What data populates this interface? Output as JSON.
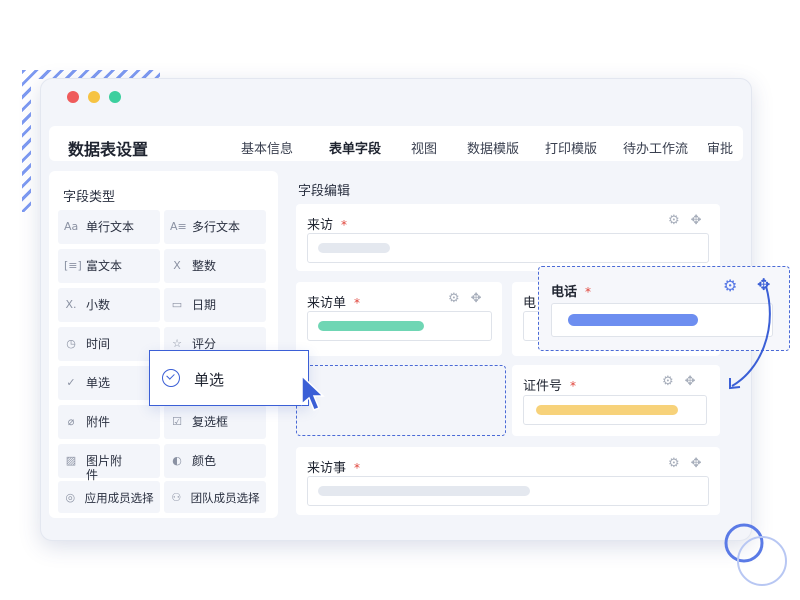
{
  "header": {
    "title": "数据表设置",
    "tabs": [
      {
        "label": "基本信息",
        "active": false
      },
      {
        "label": "表单字段",
        "active": true
      },
      {
        "label": "视图",
        "active": false
      },
      {
        "label": "数据模版",
        "active": false
      },
      {
        "label": "打印模版",
        "active": false
      },
      {
        "label": "待办工作流",
        "active": false
      },
      {
        "label": "审批",
        "active": false
      }
    ]
  },
  "sidebar": {
    "title": "字段类型",
    "items": [
      {
        "icon": "Aa",
        "label": "单行文本"
      },
      {
        "icon": "A≡",
        "label": "多行文本"
      },
      {
        "icon": "[≡]",
        "label": "富文本"
      },
      {
        "icon": "X",
        "label": "整数"
      },
      {
        "icon": "X.",
        "label": "小数"
      },
      {
        "icon": "▭",
        "label": "日期"
      },
      {
        "icon": "◷",
        "label": "时间"
      },
      {
        "icon": "☆",
        "label": "评分"
      },
      {
        "icon": "✓",
        "label": "单选"
      },
      {
        "icon": "",
        "label": ""
      },
      {
        "icon": "⌀",
        "label": "附件"
      },
      {
        "icon": "☑",
        "label": "复选框"
      },
      {
        "icon": "▨",
        "label": "图片附件"
      },
      {
        "icon": "◐",
        "label": "颜色"
      },
      {
        "icon": "◎",
        "label": "应用成员选择"
      },
      {
        "icon": "⚇",
        "label": "团队成员选择"
      }
    ]
  },
  "editor": {
    "title": "字段编辑",
    "fields": {
      "visitor": {
        "label": "来访",
        "required": "*"
      },
      "visit_form": {
        "label": "来访单",
        "required": "*"
      },
      "phone_partial": {
        "label": "电"
      },
      "id_number": {
        "label": "证件号",
        "required": "*"
      },
      "visit_matter": {
        "label": "来访事",
        "required": "*"
      }
    }
  },
  "drag_phone": {
    "label": "电话",
    "required": "*"
  },
  "drag_radio": {
    "label": "单选"
  },
  "colors": {
    "accent": "#3b5fd6",
    "bar_gray": "#e4e8ef",
    "bar_green": "#6fd6b4",
    "bar_yellow": "#f7d27a",
    "bar_blue": "#6d8ef0"
  }
}
